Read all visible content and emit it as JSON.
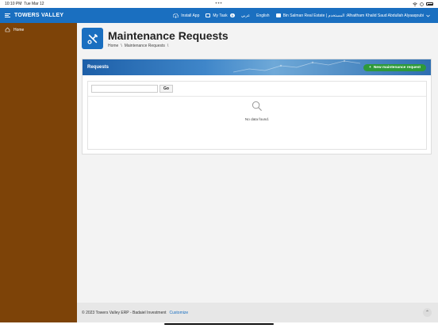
{
  "status_bar": {
    "time": "10:10 PM",
    "date": "Tue Mar 12",
    "dots": "•••"
  },
  "topbar": {
    "app_name": "TOWERS VALLEY",
    "install_app": "Install App",
    "my_task": "My Task",
    "my_task_count": "0",
    "lang_ar": "عربي",
    "lang_en": "English",
    "user_info": "Bin Salman Real Estate | المستخدم :Alhaitham Khalid Saud Abdullah Alyaaqoubi"
  },
  "sidebar": {
    "items": [
      {
        "label": "Home",
        "icon": "home-icon"
      }
    ]
  },
  "page": {
    "title": "Maintenance Requests",
    "breadcrumb": [
      "Home",
      "Maintenance Requests"
    ],
    "icon": "tools-icon"
  },
  "region": {
    "title": "Requests",
    "new_button": "New maintenance request",
    "search": {
      "value": "",
      "placeholder": ""
    },
    "go_label": "Go",
    "empty_message": "No data found."
  },
  "footer": {
    "copyright": "© 2023 Towers Valley ERP - Badaiel Investment",
    "customize": "Customize"
  },
  "colors": {
    "primary": "#1a6fc0",
    "sidebar": "#7d4308",
    "success": "#2e9a3a"
  }
}
